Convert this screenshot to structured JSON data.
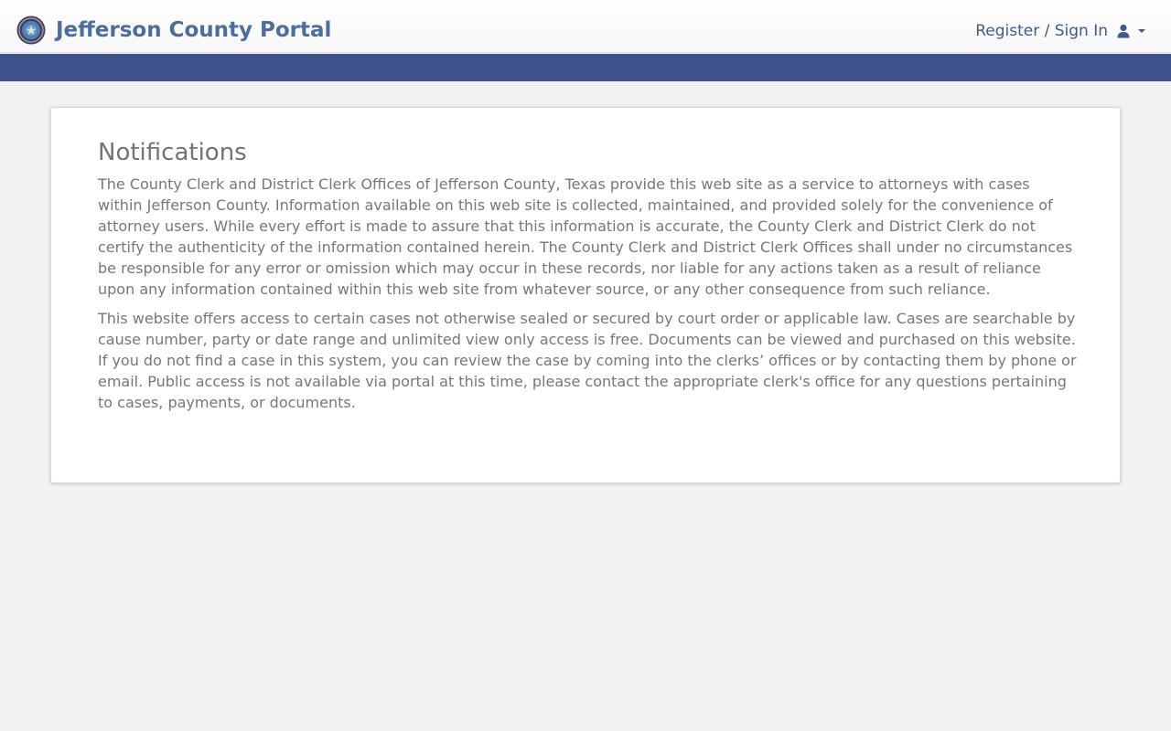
{
  "header": {
    "logo_icon": "county-seal-icon",
    "title": "Jefferson County Portal",
    "signin_label": "Register / Sign In",
    "user_icon": "user-icon",
    "caret_icon": "chevron-down-icon"
  },
  "colors": {
    "brand_text": "#4a6ea0",
    "navbar": "#3e518b",
    "background": "#f2f2f2",
    "body_text": "#777777"
  },
  "notifications": {
    "heading": "Notifications",
    "paragraphs": [
      "The County Clerk and District Clerk Offices of Jefferson County, Texas provide this web site as a service to attorneys with cases within Jefferson County. Information available on this web site is collected, maintained, and provided solely for the convenience of attorney users. While every effort is made to assure that this information is accurate, the County Clerk and District Clerk do not certify the authenticity of the information contained herein. The County Clerk and District Clerk Offices shall under no circumstances be responsible for any error or omission which may occur in these records, nor liable for any actions taken as a result of reliance upon any information contained within this web site from whatever source, or any other consequence from such reliance.",
      "This website offers access to certain cases not otherwise sealed or secured by court order or applicable law. Cases are searchable by cause number, party or date range and unlimited view only access is free. Documents can be viewed and purchased on this website. If you do not find a case in this system, you can review the case by coming into the clerks’ offices or by contacting them by phone or email. Public access is not available via portal at this time, please contact the appropriate clerk's office for any questions pertaining to cases, payments, or documents."
    ]
  }
}
